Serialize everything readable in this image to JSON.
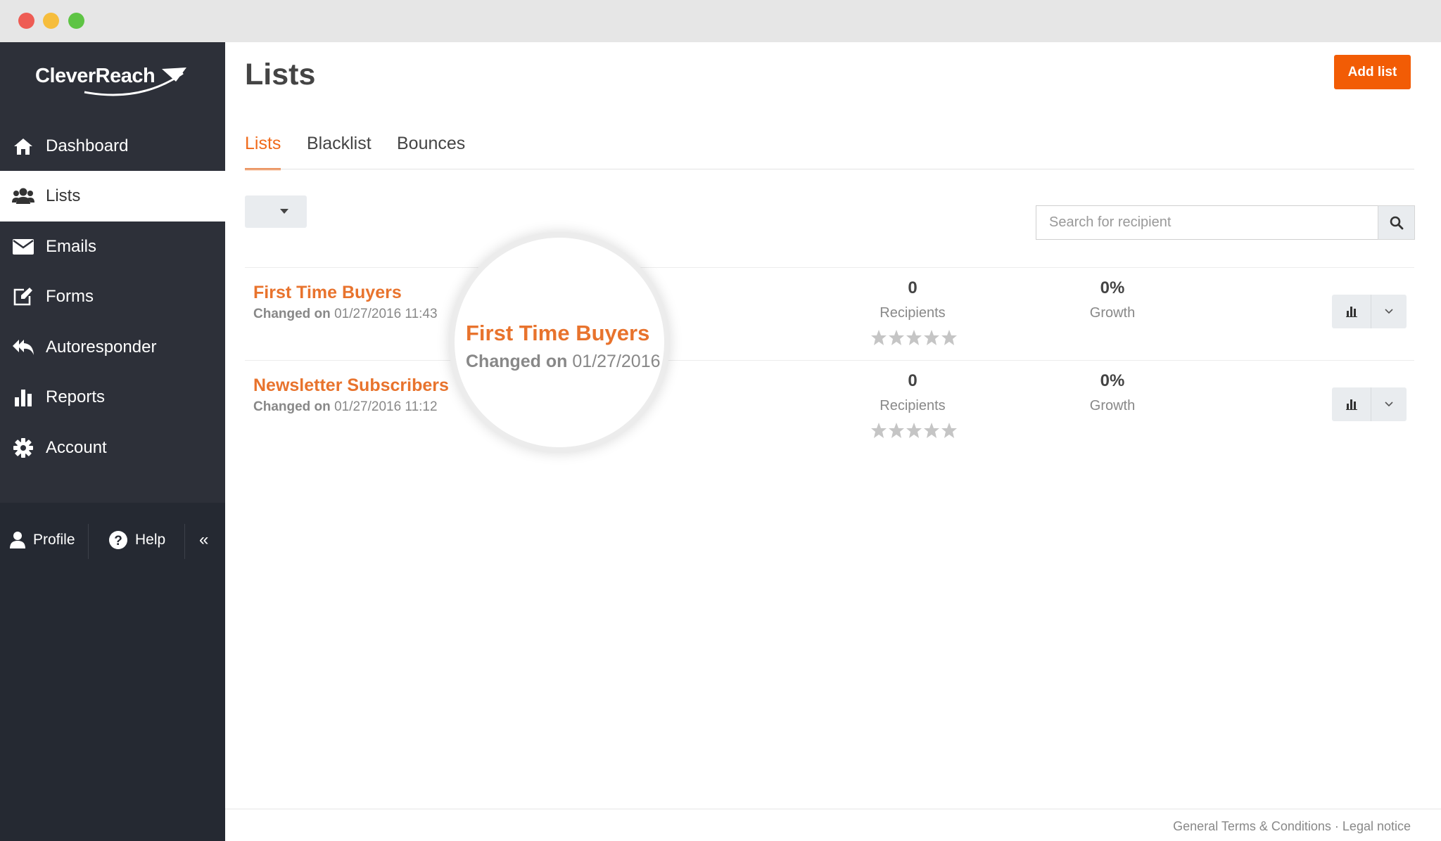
{
  "app": {
    "logo_text": "CleverReach"
  },
  "sidebar": {
    "items": [
      {
        "label": "Dashboard"
      },
      {
        "label": "Lists"
      },
      {
        "label": "Emails"
      },
      {
        "label": "Forms"
      },
      {
        "label": "Autoresponder"
      },
      {
        "label": "Reports"
      },
      {
        "label": "Account"
      }
    ],
    "footer": {
      "profile": "Profile",
      "help": "Help",
      "collapse": "«"
    }
  },
  "page": {
    "title": "Lists",
    "add_button": "Add list",
    "tabs": [
      {
        "label": "Lists"
      },
      {
        "label": "Blacklist"
      },
      {
        "label": "Bounces"
      }
    ],
    "search": {
      "placeholder": "Search for recipient"
    }
  },
  "lists": [
    {
      "name": "First Time Buyers",
      "changed_prefix": "Changed on",
      "changed_date": "01/27/2016 11:43",
      "recipients": "0",
      "recipients_label": "Recipients",
      "growth": "0%",
      "growth_label": "Growth"
    },
    {
      "name": "Newsletter Subscribers",
      "changed_prefix": "Changed on",
      "changed_date": "01/27/2016 11:12",
      "recipients": "0",
      "recipients_label": "Recipients",
      "growth": "0%",
      "growth_label": "Growth"
    }
  ],
  "magnifier": {
    "name": "First Time Buyers",
    "changed_prefix": "Changed on",
    "changed_date": "01/27/2016"
  },
  "footer": {
    "links": "General Terms & Conditions · Legal notice"
  },
  "colors": {
    "accent": "#f25c05",
    "link": "#e8732d",
    "sidebar": "#2d3039"
  }
}
